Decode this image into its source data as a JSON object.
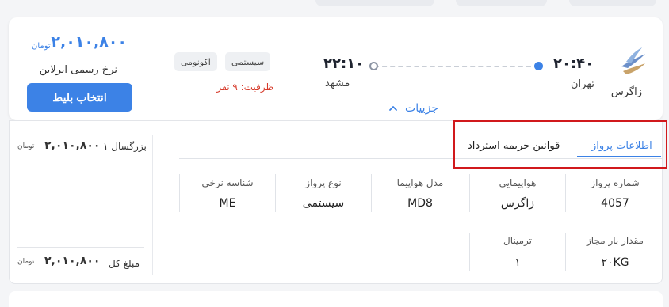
{
  "flight": {
    "airline_name": "زاگرس",
    "departure_time": "۲۰:۴۰",
    "departure_city": "تهران",
    "arrival_time": "۲۲:۱۰",
    "arrival_city": "مشهد",
    "badges": [
      "سیستمی",
      "اکونومی"
    ],
    "capacity": "ظرفیت: ۹ نفر",
    "price": "۲,۰۱۰,۸۰۰",
    "currency": "تومان",
    "fare_type": "نرخ رسمی ایرلاین",
    "select_button": "انتخاب بلیط",
    "details_toggle": "جزییات"
  },
  "details": {
    "tabs": [
      "اطلاعات پرواز",
      "قوانین جریمه استرداد"
    ],
    "active_tab": 0,
    "info_row1": [
      {
        "label": "شماره پرواز",
        "value": "4057"
      },
      {
        "label": "هواپیمایی",
        "value": "زاگرس"
      },
      {
        "label": "مدل هواپیما",
        "value": "MD8"
      },
      {
        "label": "نوع پرواز",
        "value": "سیستمی"
      },
      {
        "label": "شناسه نرخی",
        "value": "ME"
      }
    ],
    "info_row2": [
      {
        "label": "مقدار بار مجاز",
        "value": "۲۰KG"
      },
      {
        "label": "ترمینال",
        "value": "۱"
      }
    ]
  },
  "summary": {
    "passenger_line": "۱ بزرگسال",
    "passenger_price": "۲,۰۱۰,۸۰۰",
    "total_label": "مبلغ کل",
    "total_price": "۲,۰۱۰,۸۰۰",
    "currency": "تومان"
  },
  "colors": {
    "accent": "#3c82e6",
    "warning": "#d63a2a",
    "highlight": "#d1191c"
  }
}
